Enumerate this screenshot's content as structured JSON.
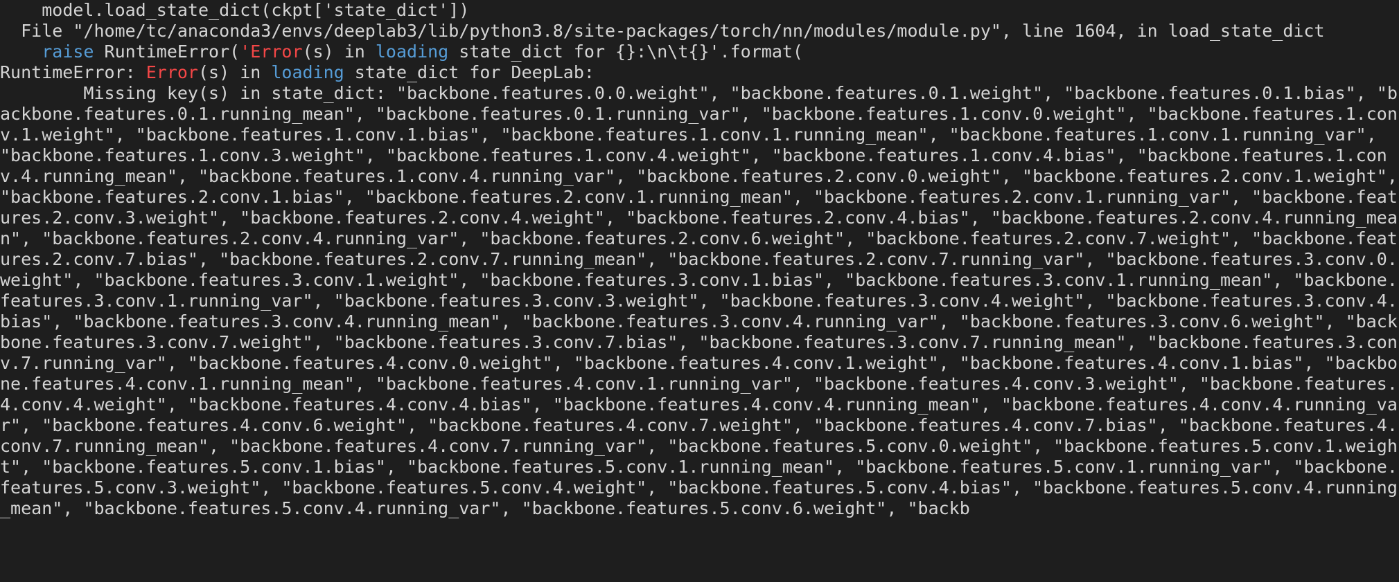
{
  "traceback": {
    "l1": "    model.load_state_dict(ckpt['state_dict'])",
    "l2": "  File \"/home/tc/anaconda3/envs/deeplab3/lib/python3.8/site-packages/torch/nn/modules/module.py\", line 1604, in load_state_dict",
    "l3a": "    ",
    "l3b": "raise",
    "l3c": " RuntimeError(",
    "l3d": "'Error",
    "l3e": "(s) in ",
    "l3f": "loading",
    "l3g": " state_dict for {}:\\n\\t{}'",
    "l3h": ".format(",
    "l4a": "RuntimeError: ",
    "l4b": "Error",
    "l4c": "(s) in ",
    "l4d": "loading",
    "l4e": " state_dict for DeepLab:",
    "body": "        Missing key(s) in state_dict: \"backbone.features.0.0.weight\", \"backbone.features.0.1.weight\", \"backbone.features.0.1.bias\", \"backbone.features.0.1.running_mean\", \"backbone.features.0.1.running_var\", \"backbone.features.1.conv.0.weight\", \"backbone.features.1.conv.1.weight\", \"backbone.features.1.conv.1.bias\", \"backbone.features.1.conv.1.running_mean\", \"backbone.features.1.conv.1.running_var\", \"backbone.features.1.conv.3.weight\", \"backbone.features.1.conv.4.weight\", \"backbone.features.1.conv.4.bias\", \"backbone.features.1.conv.4.running_mean\", \"backbone.features.1.conv.4.running_var\", \"backbone.features.2.conv.0.weight\", \"backbone.features.2.conv.1.weight\", \"backbone.features.2.conv.1.bias\", \"backbone.features.2.conv.1.running_mean\", \"backbone.features.2.conv.1.running_var\", \"backbone.features.2.conv.3.weight\", \"backbone.features.2.conv.4.weight\", \"backbone.features.2.conv.4.bias\", \"backbone.features.2.conv.4.running_mean\", \"backbone.features.2.conv.4.running_var\", \"backbone.features.2.conv.6.weight\", \"backbone.features.2.conv.7.weight\", \"backbone.features.2.conv.7.bias\", \"backbone.features.2.conv.7.running_mean\", \"backbone.features.2.conv.7.running_var\", \"backbone.features.3.conv.0.weight\", \"backbone.features.3.conv.1.weight\", \"backbone.features.3.conv.1.bias\", \"backbone.features.3.conv.1.running_mean\", \"backbone.features.3.conv.1.running_var\", \"backbone.features.3.conv.3.weight\", \"backbone.features.3.conv.4.weight\", \"backbone.features.3.conv.4.bias\", \"backbone.features.3.conv.4.running_mean\", \"backbone.features.3.conv.4.running_var\", \"backbone.features.3.conv.6.weight\", \"backbone.features.3.conv.7.weight\", \"backbone.features.3.conv.7.bias\", \"backbone.features.3.conv.7.running_mean\", \"backbone.features.3.conv.7.running_var\", \"backbone.features.4.conv.0.weight\", \"backbone.features.4.conv.1.weight\", \"backbone.features.4.conv.1.bias\", \"backbone.features.4.conv.1.running_mean\", \"backbone.features.4.conv.1.running_var\", \"backbone.features.4.conv.3.weight\", \"backbone.features.4.conv.4.weight\", \"backbone.features.4.conv.4.bias\", \"backbone.features.4.conv.4.running_mean\", \"backbone.features.4.conv.4.running_var\", \"backbone.features.4.conv.6.weight\", \"backbone.features.4.conv.7.weight\", \"backbone.features.4.conv.7.bias\", \"backbone.features.4.conv.7.running_mean\", \"backbone.features.4.conv.7.running_var\", \"backbone.features.5.conv.0.weight\", \"backbone.features.5.conv.1.weight\", \"backbone.features.5.conv.1.bias\", \"backbone.features.5.conv.1.running_mean\", \"backbone.features.5.conv.1.running_var\", \"backbone.features.5.conv.3.weight\", \"backbone.features.5.conv.4.weight\", \"backbone.features.5.conv.4.bias\", \"backbone.features.5.conv.4.running_mean\", \"backbone.features.5.conv.4.running_var\", \"backbone.features.5.conv.6.weight\", \"backb"
  }
}
